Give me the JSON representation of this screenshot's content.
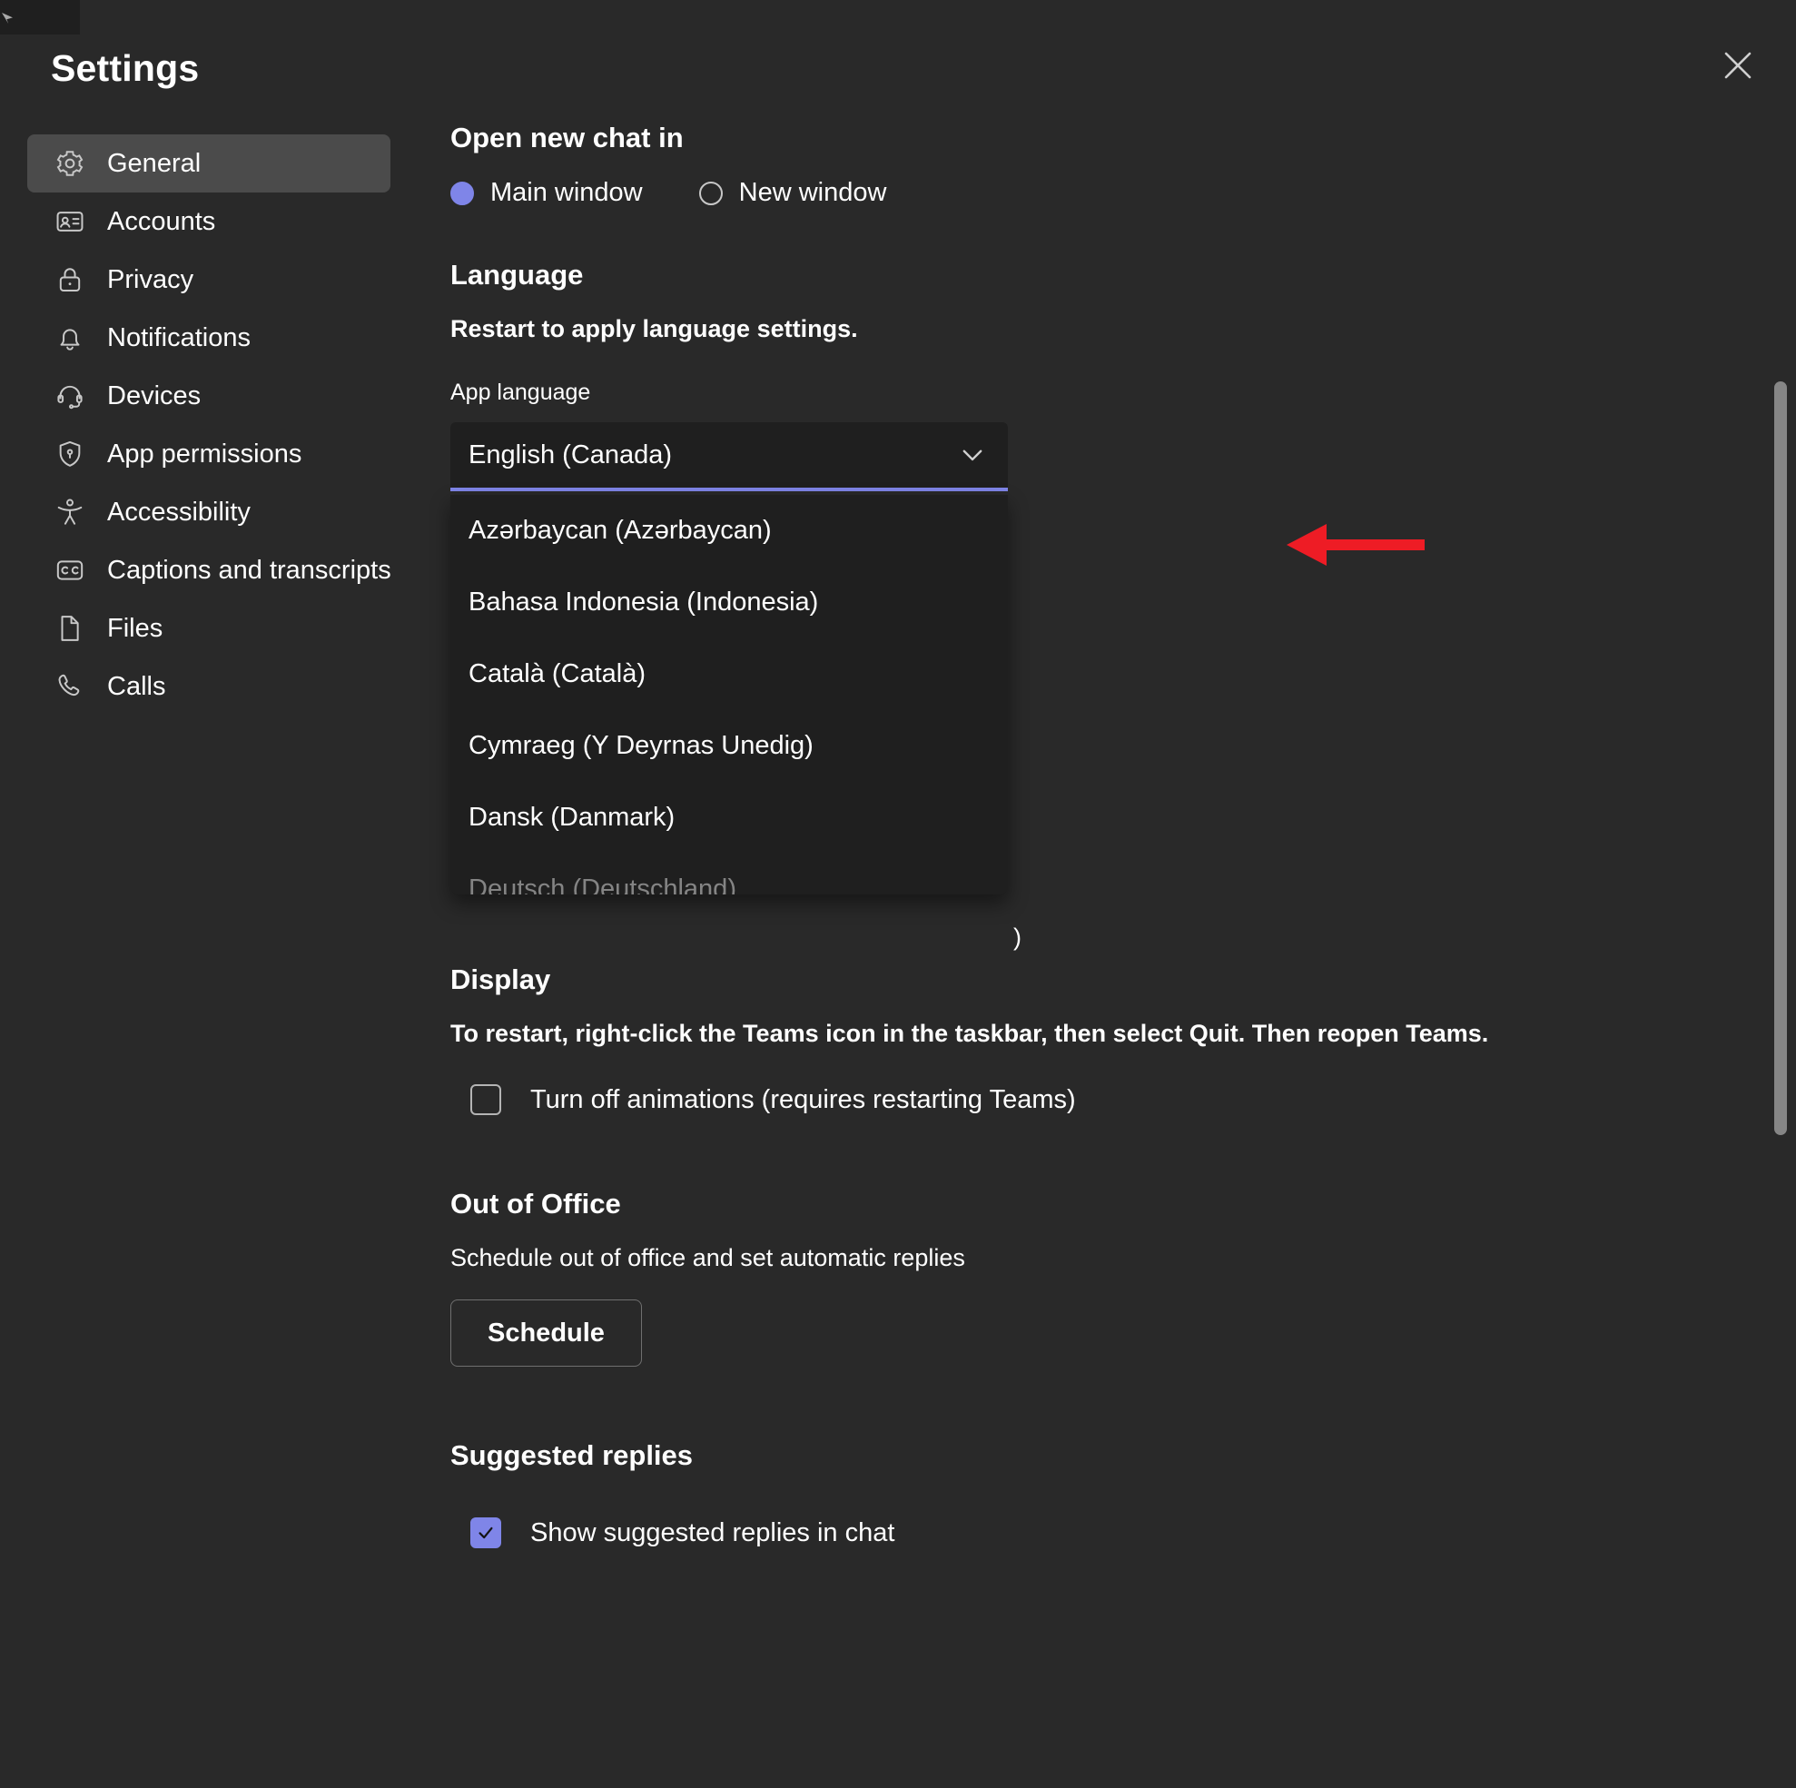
{
  "window": {
    "title": "Settings",
    "close_icon": "close-icon"
  },
  "sidebar": {
    "items": [
      {
        "label": "General",
        "icon": "gear-icon",
        "active": true
      },
      {
        "label": "Accounts",
        "icon": "contact-card-icon",
        "active": false
      },
      {
        "label": "Privacy",
        "icon": "lock-icon",
        "active": false
      },
      {
        "label": "Notifications",
        "icon": "bell-icon",
        "active": false
      },
      {
        "label": "Devices",
        "icon": "headset-icon",
        "active": false
      },
      {
        "label": "App permissions",
        "icon": "shield-lock-icon",
        "active": false
      },
      {
        "label": "Accessibility",
        "icon": "accessibility-person-icon",
        "active": false
      },
      {
        "label": "Captions and transcripts",
        "icon": "closed-caption-icon",
        "active": false
      },
      {
        "label": "Files",
        "icon": "document-icon",
        "active": false
      },
      {
        "label": "Calls",
        "icon": "phone-icon",
        "active": false
      }
    ]
  },
  "main": {
    "open_new_chat": {
      "heading": "Open new chat in",
      "options": [
        {
          "label": "Main window",
          "selected": true
        },
        {
          "label": "New window",
          "selected": false
        }
      ]
    },
    "language": {
      "heading": "Language",
      "restart_note": "Restart to apply language settings.",
      "field_label": "App language",
      "selected_value": "English (Canada)",
      "chevron_icon": "chevron-down-icon",
      "dropdown_open": true,
      "options": [
        "Azərbaycan (Azərbaycan)",
        "Bahasa Indonesia (Indonesia)",
        "Català (Català)",
        "Cymraeg (Y Deyrnas Unedig)",
        "Dansk (Danmark)",
        "Deutsch (Deutschland)"
      ],
      "obscured_text_fragment": ")"
    },
    "display": {
      "heading": "Display",
      "note": "To restart, right-click the Teams icon in the taskbar, then select Quit. Then reopen Teams.",
      "checkbox": {
        "label": "Turn off animations (requires restarting Teams)",
        "checked": false
      }
    },
    "out_of_office": {
      "heading": "Out of Office",
      "description": "Schedule out of office and set automatic replies",
      "button_label": "Schedule"
    },
    "suggested_replies": {
      "heading": "Suggested replies",
      "checkbox": {
        "label": "Show suggested replies in chat",
        "checked": true
      }
    }
  },
  "annotation": {
    "arrow_color": "#ee1c25",
    "arrow_direction": "left",
    "points_to": "app-language-combobox"
  },
  "colors": {
    "accent": "#7f85e8",
    "background": "#292929",
    "panel": "#1f1f1f",
    "active_nav": "#4b4b4b",
    "text": "#ffffff"
  }
}
